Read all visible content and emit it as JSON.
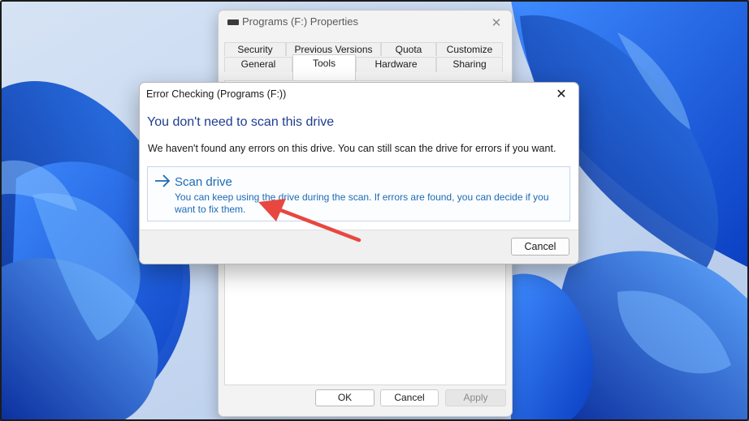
{
  "properties_window": {
    "title": "Programs (F:) Properties",
    "tabs_top": [
      "Security",
      "Previous Versions",
      "Quota",
      "Customize"
    ],
    "tabs_bottom": [
      "General",
      "Tools",
      "Hardware",
      "Sharing"
    ],
    "active_tab": "Tools",
    "buttons": {
      "ok": "OK",
      "cancel": "Cancel",
      "apply": "Apply"
    }
  },
  "dialog": {
    "title": "Error Checking (Programs (F:))",
    "heading": "You don't need to scan this drive",
    "message": "We haven't found any errors on this drive. You can still scan the drive for errors if you want.",
    "command": {
      "title": "Scan drive",
      "description": "You can keep using the drive during the scan. If errors are found, you can decide if you want to fix them."
    },
    "cancel_label": "Cancel"
  },
  "colors": {
    "heading": "#1f3d92",
    "link": "#1d6ab5",
    "annotation_arrow": "#e8473f"
  },
  "icons": {
    "close": "close-icon",
    "command_arrow": "arrow-right-icon",
    "window_icon": "drive-icon"
  }
}
